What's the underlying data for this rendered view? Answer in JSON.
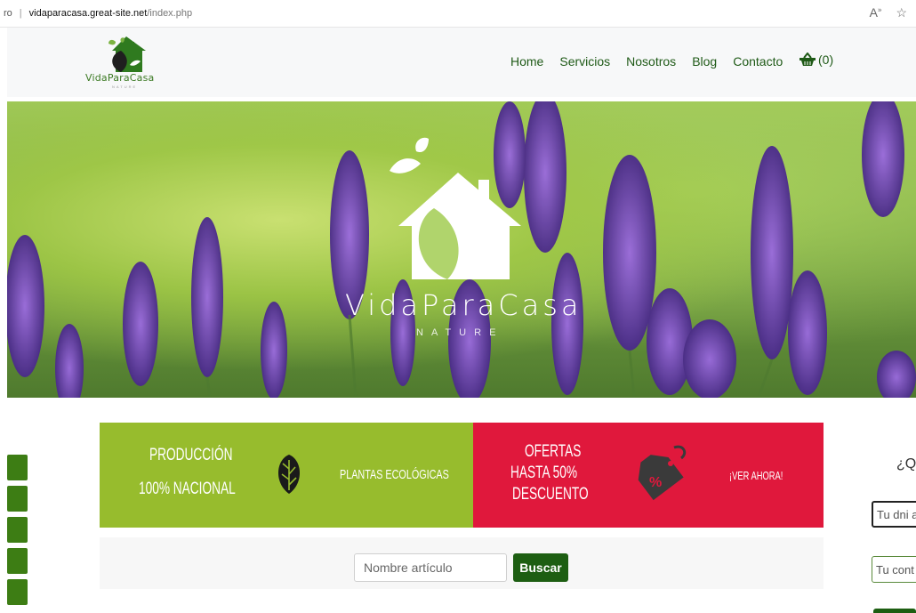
{
  "browser": {
    "address_prefix": "ro",
    "domain": "vidaparacasa.great-site.net",
    "path": "/index.php",
    "read_aloud_icon": "A",
    "favorite_icon": "☆"
  },
  "header": {
    "logo_text": "VidaParaCasa",
    "logo_sub": "NATURE",
    "nav": [
      "Home",
      "Servicios",
      "Nosotros",
      "Blog",
      "Contacto"
    ],
    "cart_count": "(0)"
  },
  "hero": {
    "title": "VidaParaCasa",
    "subtitle": "NATURE"
  },
  "promo": {
    "green_left_line1": "PRODUCCIÓN",
    "green_left_line2": "100% NACIONAL",
    "green_right": "PLANTAS ECOLÓGICAS",
    "red_line1": "OFERTAS",
    "red_line2": "HASTA 50%",
    "red_line3": "DESCUENTO",
    "red_tag_symbol": "%",
    "red_right": "¡VER AHORA!"
  },
  "search": {
    "placeholder": "Nombre artículo",
    "button_label": "Buscar"
  },
  "right_panel": {
    "question_fragment": "¿Q",
    "dni_placeholder": "Tu dni a",
    "password_placeholder": "Tu cont"
  },
  "colors": {
    "brand_green": "#1d5e12",
    "promo_green": "#97bc2d",
    "promo_red": "#e0183c",
    "side_tab": "#3d7d14"
  }
}
